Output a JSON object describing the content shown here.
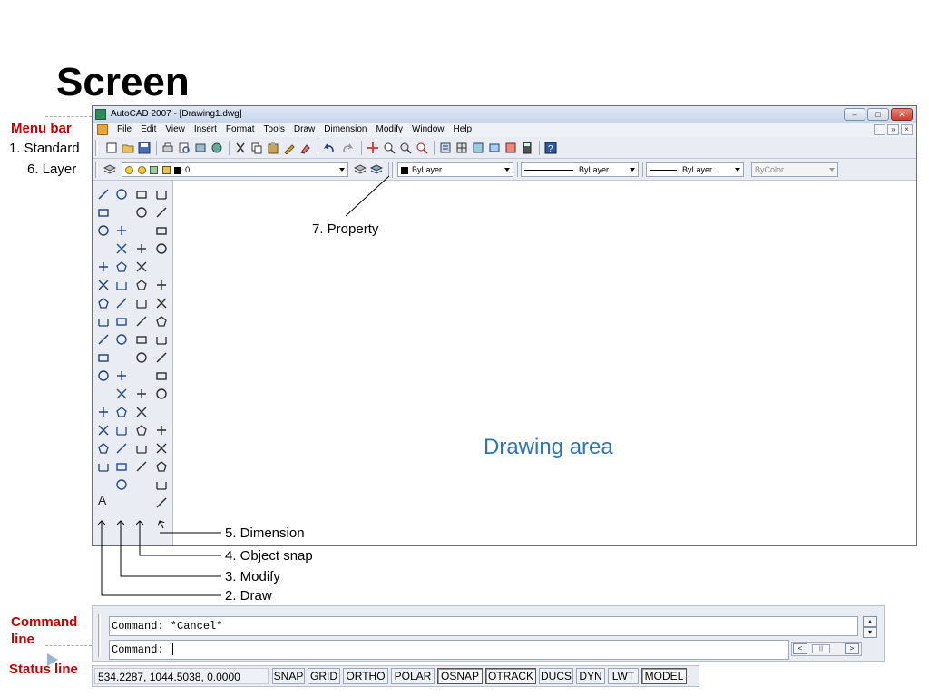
{
  "slide": {
    "title": "Screen"
  },
  "labels": {
    "menu_bar": "Menu bar",
    "standard": "1. Standard",
    "layer": "6. Layer",
    "command_line_1": "Command",
    "command_line_2": "line",
    "status_line": "Status line",
    "property": "7. Property",
    "dimension": "5. Dimension",
    "object_snap": "4. Object snap",
    "modify": "3. Modify",
    "draw": "2. Draw"
  },
  "window": {
    "title": "AutoCAD 2007 - [Drawing1.dwg]",
    "minimize": "–",
    "maximize": "□",
    "close": "✕",
    "mdi_minimize": "_",
    "mdi_restore": "»",
    "mdi_close": "×"
  },
  "menubar": {
    "items": [
      "File",
      "Edit",
      "View",
      "Insert",
      "Format",
      "Tools",
      "Draw",
      "Dimension",
      "Modify",
      "Window",
      "Help"
    ]
  },
  "layer_toolbar": {
    "layer_name": "0",
    "color": "ByLayer",
    "linetype": "ByLayer",
    "lineweight": "ByLayer",
    "plotstyle": "ByColor"
  },
  "drawing_area": {
    "label": "Drawing area",
    "text_tool": "A"
  },
  "command_line": {
    "line1": "Command: *Cancel*",
    "line2": "Command: ",
    "scroll_up": "▴",
    "scroll_down": "▾",
    "scroll_left": "<",
    "scroll_right": ">",
    "thumb_grip": "|||"
  },
  "statusbar": {
    "coordinates": "534.2287,  1044.5038, 0.0000",
    "buttons": [
      {
        "label": "SNAP",
        "on": false
      },
      {
        "label": "GRID",
        "on": false
      },
      {
        "label": "ORTHO",
        "on": false
      },
      {
        "label": "POLAR",
        "on": false
      },
      {
        "label": "OSNAP",
        "on": true
      },
      {
        "label": "OTRACK",
        "on": true
      },
      {
        "label": "DUCS",
        "on": false
      },
      {
        "label": "DYN",
        "on": false
      },
      {
        "label": "LWT",
        "on": false
      },
      {
        "label": "MODEL",
        "on": true
      }
    ]
  },
  "colors": {
    "accent_blue": "#2f75b5",
    "label_red": "#c00000",
    "toolbar_bg": "#e9edf3"
  }
}
